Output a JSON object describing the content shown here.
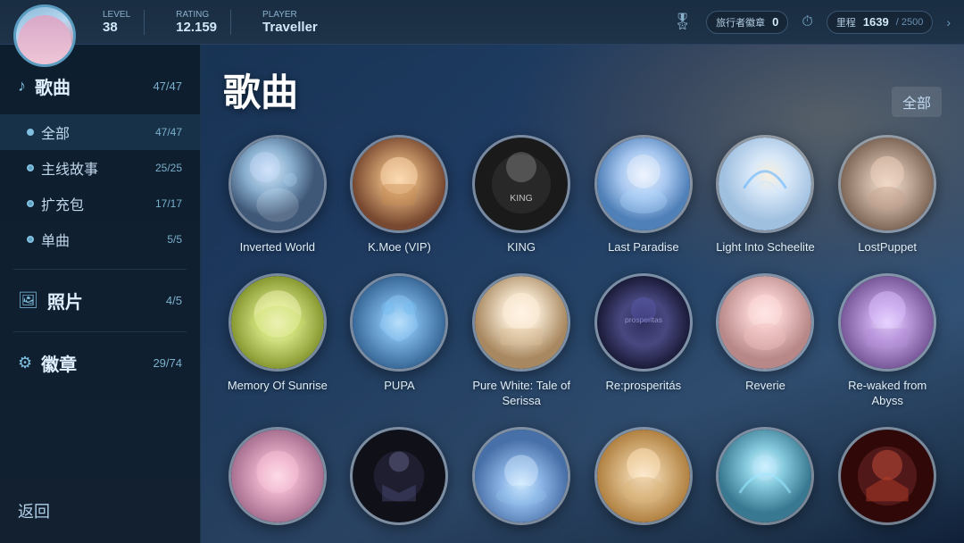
{
  "topBar": {
    "level_label": "Level",
    "level_value": "38",
    "rating_label": "Rating",
    "rating_value": "12.159",
    "player_label": "Player",
    "player_value": "Traveller",
    "badge_label": "旅行者徽章",
    "badge_value": "0",
    "milestone_label": "里程",
    "milestone_value": "1639",
    "milestone_max": "2500"
  },
  "sidebar": {
    "songs_icon": "♪",
    "songs_label": "歌曲",
    "songs_count": "47/47",
    "sub_items": [
      {
        "label": "全部",
        "count": "47/47",
        "active": true
      },
      {
        "label": "主线故事",
        "count": "25/25",
        "active": false
      },
      {
        "label": "扩充包",
        "count": "17/17",
        "active": false
      },
      {
        "label": "单曲",
        "count": "5/5",
        "active": false
      }
    ],
    "photos_icon": "🖼",
    "photos_label": "照片",
    "photos_count": "4/5",
    "badges_icon": "⚙",
    "badges_label": "徽章",
    "badges_count": "29/74",
    "back_label": "返回",
    "filter_label": "全部"
  },
  "songArea": {
    "title": "歌曲",
    "filter": "全部",
    "songs": [
      {
        "name": "Inverted World",
        "thumb": "thumb-1"
      },
      {
        "name": "K.Moe (VIP)",
        "thumb": "thumb-2"
      },
      {
        "name": "KING",
        "thumb": "thumb-3"
      },
      {
        "name": "Last Paradise",
        "thumb": "thumb-4"
      },
      {
        "name": "Light Into Scheelite",
        "thumb": "thumb-5"
      },
      {
        "name": "LostPuppet",
        "thumb": "thumb-6"
      },
      {
        "name": "Memory Of Sunrise",
        "thumb": "thumb-7"
      },
      {
        "name": "PUPA",
        "thumb": "thumb-8"
      },
      {
        "name": "Pure White: Tale of Serissa",
        "thumb": "thumb-9"
      },
      {
        "name": "Re:prosperitás",
        "thumb": "thumb-10"
      },
      {
        "name": "Reverie",
        "thumb": "thumb-11"
      },
      {
        "name": "Re-waked from Abyss",
        "thumb": "thumb-12"
      },
      {
        "name": "",
        "thumb": "thumb-13"
      },
      {
        "name": "",
        "thumb": "thumb-14"
      },
      {
        "name": "",
        "thumb": "thumb-15"
      },
      {
        "name": "",
        "thumb": "thumb-16"
      },
      {
        "name": "",
        "thumb": "thumb-17"
      },
      {
        "name": "",
        "thumb": "thumb-18"
      }
    ]
  }
}
